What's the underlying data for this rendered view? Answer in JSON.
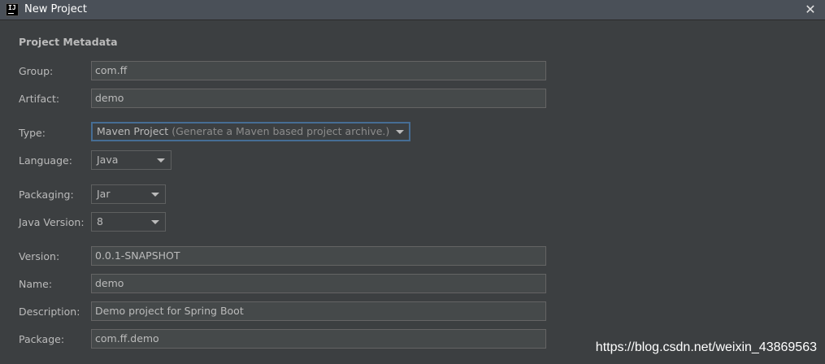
{
  "window": {
    "title": "New Project",
    "app_icon_text": "IJ"
  },
  "section": {
    "title": "Project Metadata"
  },
  "fields": {
    "group": {
      "label": "Group:",
      "value": "com.ff"
    },
    "artifact": {
      "label": "Artifact:",
      "value": "demo"
    },
    "type": {
      "label": "Type:",
      "value": "Maven Project",
      "hint": "(Generate a Maven based project archive.)"
    },
    "language": {
      "label": "Language:",
      "value": "Java"
    },
    "packaging": {
      "label": "Packaging:",
      "value": "Jar"
    },
    "java_version": {
      "label": "Java Version:",
      "value": "8"
    },
    "version": {
      "label": "Version:",
      "value": "0.0.1-SNAPSHOT"
    },
    "name": {
      "label": "Name:",
      "value": "demo"
    },
    "description": {
      "label": "Description:",
      "value": "Demo project for Spring Boot"
    },
    "package": {
      "label": "Package:",
      "value": "com.ff.demo"
    }
  },
  "watermark": "https://blog.csdn.net/weixin_43869563"
}
